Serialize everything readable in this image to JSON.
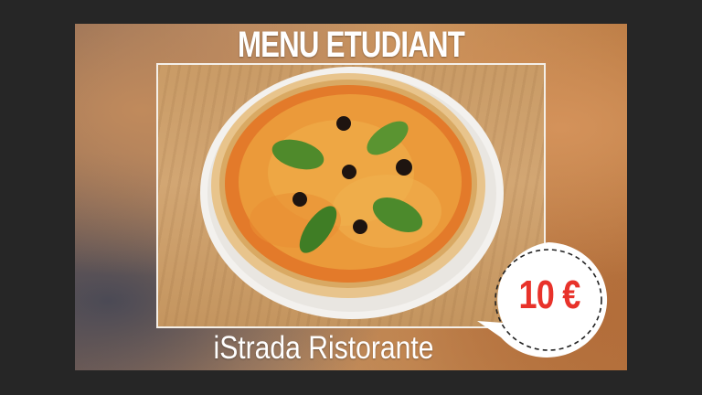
{
  "slide": {
    "title": "MENU ETUDIANT",
    "restaurant_name": "iStrada Ristorante",
    "price": "10 €",
    "photo_subject": "pizza-margherita-image"
  },
  "colors": {
    "background": "#262626",
    "price_red": "#e8322a",
    "title_white": "#ffffff",
    "badge_fill": "#ffffff"
  }
}
